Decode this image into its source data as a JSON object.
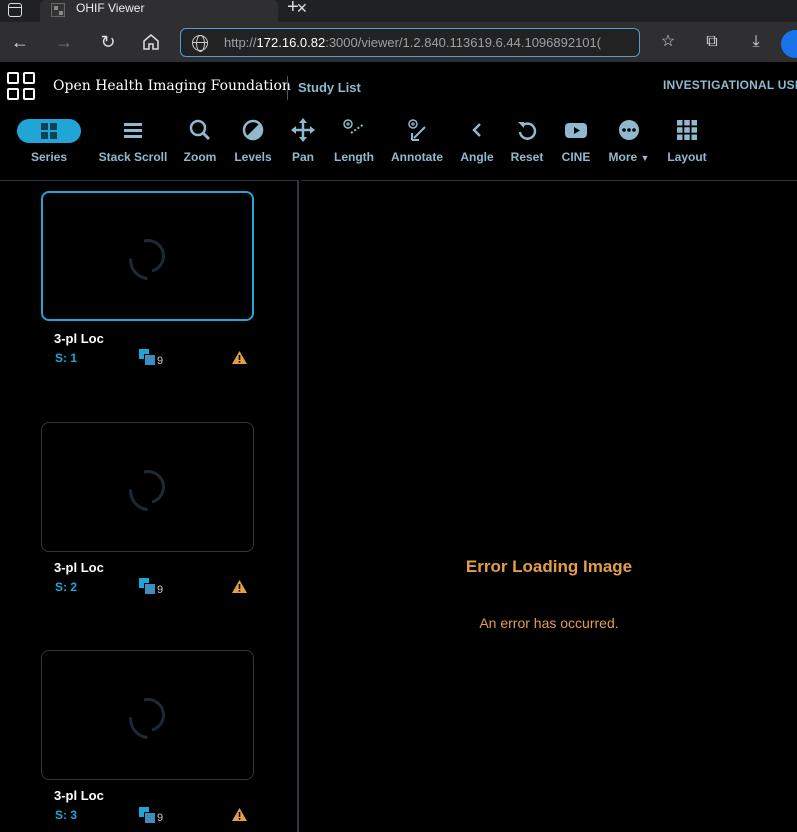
{
  "browser": {
    "tab_title": "OHIF Viewer",
    "url_prefix": "http://",
    "url_host": "172.16.0.82",
    "url_rest": ":3000/viewer/1.2.840.113619.6.44.1096892101("
  },
  "header": {
    "brand": "Open Health Imaging Foundation",
    "study_list": "Study List",
    "investigational": "INVESTIGATIONAL USE"
  },
  "toolbar": {
    "items": [
      {
        "label": "Series",
        "icon": "grid-icon"
      },
      {
        "label": "Stack Scroll",
        "icon": "bars-icon"
      },
      {
        "label": "Zoom",
        "icon": "search-icon"
      },
      {
        "label": "Levels",
        "icon": "levels-icon"
      },
      {
        "label": "Pan",
        "icon": "arrows-icon"
      },
      {
        "label": "Length",
        "icon": "ruler-icon"
      },
      {
        "label": "Annotate",
        "icon": "annotate-icon"
      },
      {
        "label": "Angle",
        "icon": "angle-icon"
      },
      {
        "label": "Reset",
        "icon": "reset-icon"
      },
      {
        "label": "CINE",
        "icon": "youtube-icon"
      },
      {
        "label": "More",
        "icon": "ellipse-icon"
      },
      {
        "label": "Layout",
        "icon": "layout-icon"
      }
    ]
  },
  "thumbnails": [
    {
      "title": "3-pl Loc",
      "series": "S: 1",
      "count": "9"
    },
    {
      "title": "3-pl Loc",
      "series": "S: 2",
      "count": "9"
    },
    {
      "title": "3-pl Loc",
      "series": "S: 3",
      "count": "9"
    }
  ],
  "viewport": {
    "error_title": "Error Loading Image",
    "error_message": "An error has occurred."
  },
  "colors": {
    "accent": "#20a5d6",
    "label": "#91b9cd",
    "error": "#e29e4a",
    "warning": "#e29e4a"
  }
}
